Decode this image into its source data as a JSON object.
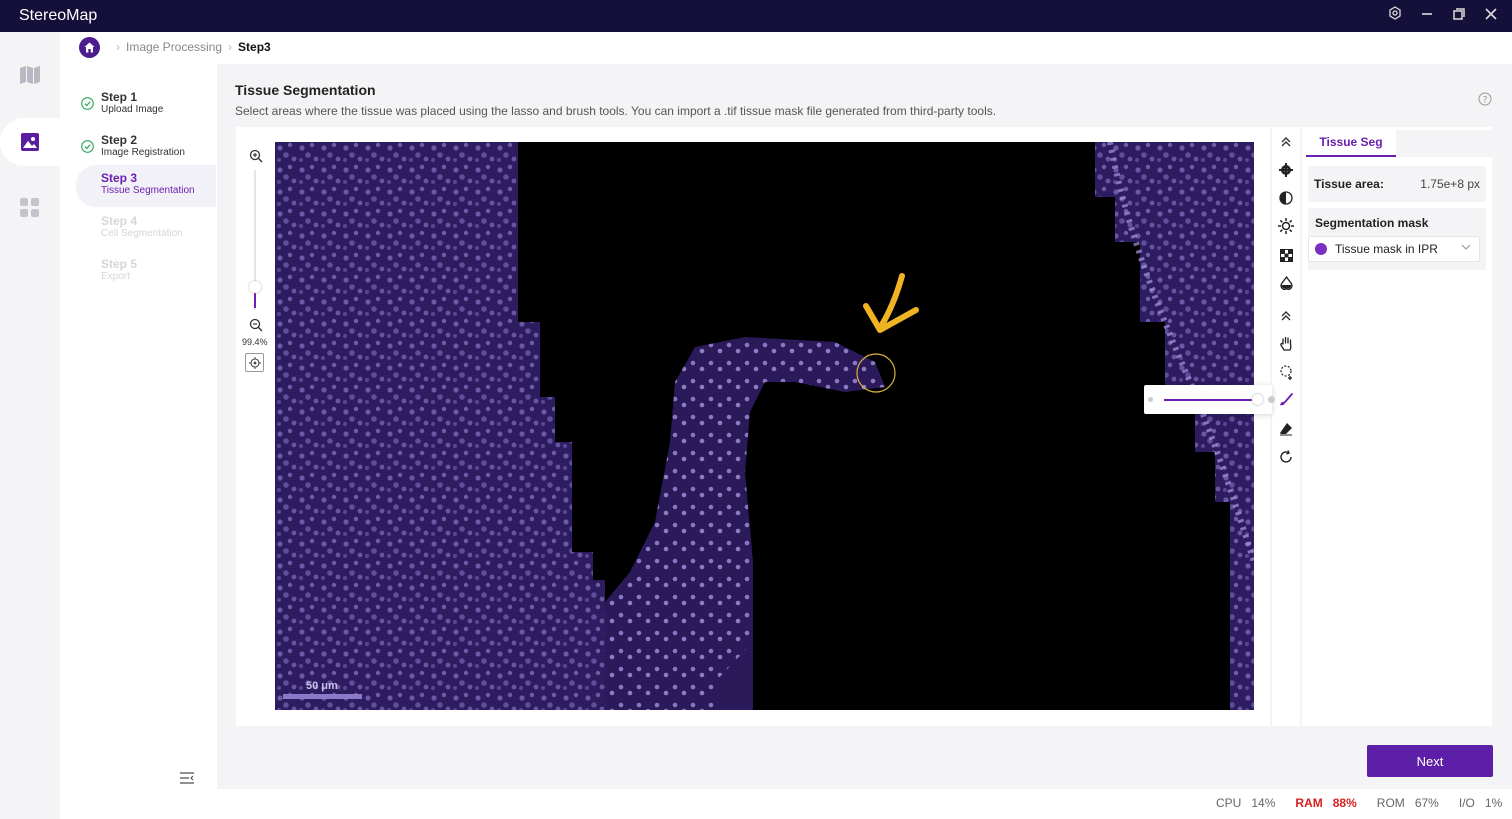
{
  "app": {
    "title": "StereoMap"
  },
  "window_buttons": {
    "settings": "settings-icon",
    "minimize": "minimize-icon",
    "restore": "restore-icon",
    "close": "close-icon"
  },
  "breadcrumb": {
    "items": [
      "Image Processing",
      "Step3"
    ]
  },
  "steps": [
    {
      "title": "Step 1",
      "subtitle": "Upload Image",
      "state": "done"
    },
    {
      "title": "Step 2",
      "subtitle": "Image Registration",
      "state": "done"
    },
    {
      "title": "Step 3",
      "subtitle": "Tissue Segmentation",
      "state": "active"
    },
    {
      "title": "Step 4",
      "subtitle": "Cell Segmentation",
      "state": "disabled"
    },
    {
      "title": "Step 5",
      "subtitle": "Export",
      "state": "disabled"
    }
  ],
  "header": {
    "title": "Tissue Segmentation",
    "description": "Select areas where the tissue was placed using the lasso and brush tools. You can import a .tif tissue mask file generated from third-party tools."
  },
  "viewer": {
    "zoom_percent": "99.4%",
    "zoom_level_fraction": 0.12,
    "scalebar_label": "50 μm"
  },
  "panel": {
    "tab": "Tissue Seg",
    "tissue_area_label": "Tissue area:",
    "tissue_area_value": "1.75e+8 px",
    "mask_heading": "Segmentation mask",
    "mask_selected": "Tissue mask in IPR"
  },
  "actions": {
    "next_label": "Next"
  },
  "status": {
    "cpu_label": "CPU",
    "cpu_value": "14%",
    "ram_label": "RAM",
    "ram_value": "88%",
    "rom_label": "ROM",
    "rom_value": "67%",
    "io_label": "I/O",
    "io_value": "1%"
  },
  "colors": {
    "accent": "#6a1fb0",
    "titlebar": "#15103a",
    "ram_warning": "#d62020",
    "tissue": "#2c1a5c"
  }
}
